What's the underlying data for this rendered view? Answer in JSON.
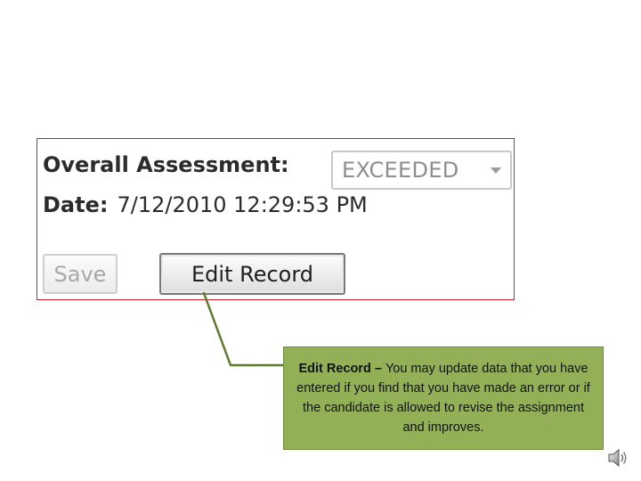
{
  "panel": {
    "assessment_label": "Overall Assessment:",
    "assessment_value": "EXCEEDED",
    "date_label": "Date:",
    "date_value": "7/12/2010 12:29:53 PM",
    "save_label": "Save",
    "edit_label": "Edit Record",
    "border_color": "#c9202a"
  },
  "callout": {
    "title": "Edit Record",
    "separator": " – ",
    "body": "You may update data that you have entered if you find that you have made an error or if the candidate is allowed to revise the assignment and improves.",
    "background": "#92b157"
  },
  "icons": {
    "dropdown": "chevron-down-icon",
    "audio": "speaker-icon"
  }
}
